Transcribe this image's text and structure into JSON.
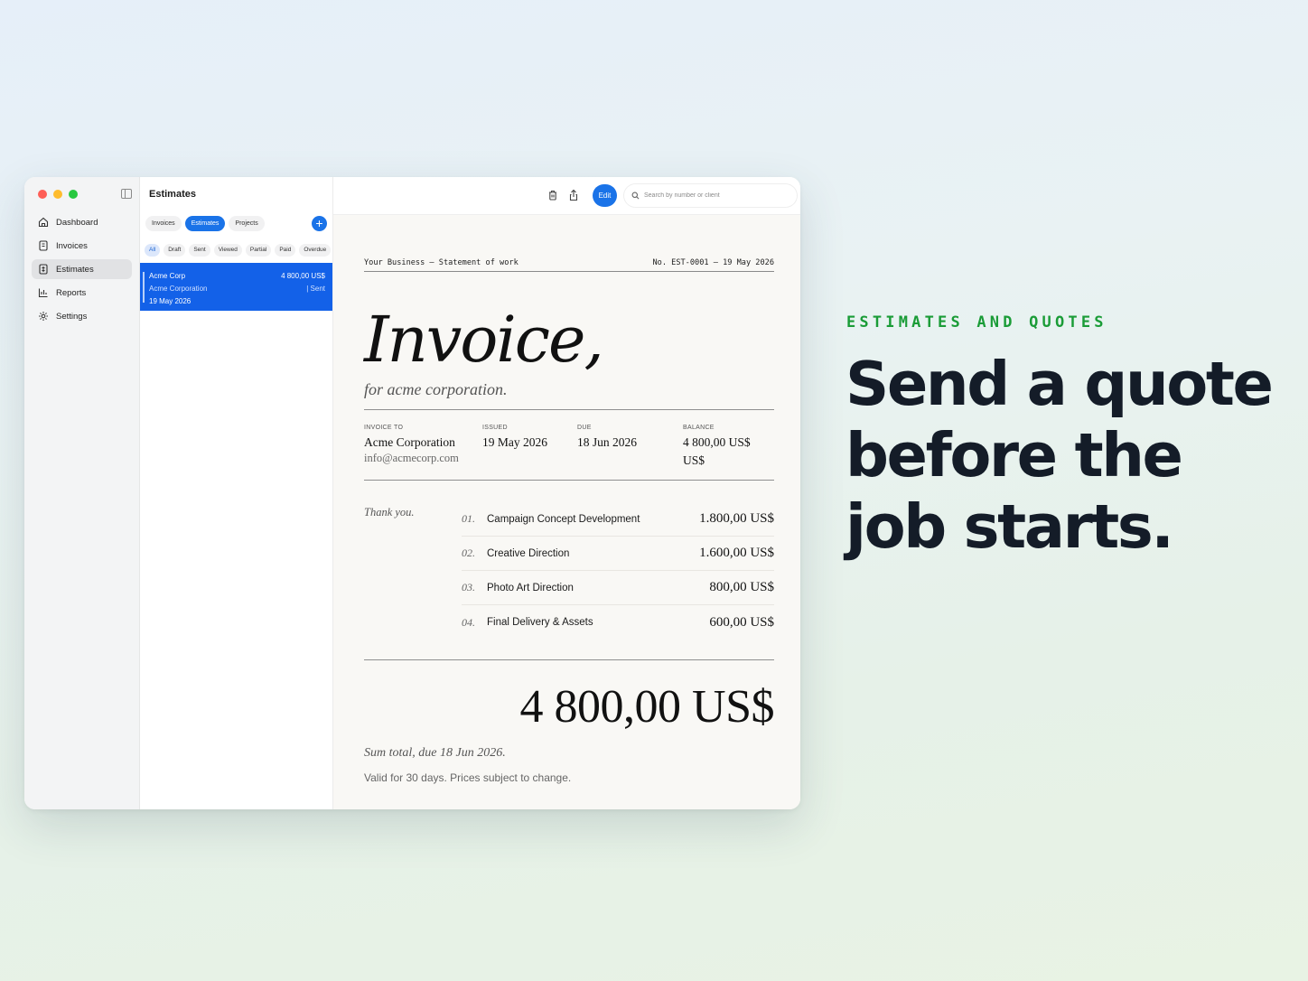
{
  "colors": {
    "accent": "#1a73e8",
    "selected_row": "#1361e8",
    "eyebrow_green": "#1a9c37",
    "headline": "#141c28",
    "traffic_red": "#fe5f57",
    "traffic_yellow": "#febc2e",
    "traffic_green": "#28c840"
  },
  "sidebar": {
    "items": [
      {
        "label": "Dashboard",
        "icon": "dashboard-icon"
      },
      {
        "label": "Invoices",
        "icon": "invoice-doc-icon"
      },
      {
        "label": "Estimates",
        "icon": "estimate-doc-icon",
        "active": true
      },
      {
        "label": "Reports",
        "icon": "bar-chart-icon"
      },
      {
        "label": "Settings",
        "icon": "gear-icon"
      }
    ]
  },
  "list": {
    "title": "Estimates",
    "segments": [
      "Invoices",
      "Estimates",
      "Projects"
    ],
    "active_segment": "Estimates",
    "filters": [
      "All",
      "Draft",
      "Sent",
      "Viewed",
      "Partial",
      "Paid",
      "Overdue"
    ],
    "active_filter": "All",
    "rows": [
      {
        "client": "Acme Corp",
        "amount": "4 800,00 US$",
        "company": "Acme Corporation",
        "status": "| Sent",
        "date": "19 May 2026"
      }
    ]
  },
  "toolbar": {
    "edit_label": "Edit",
    "search_placeholder": "Search by number or client"
  },
  "document": {
    "header_left": "Your Business — Statement of work",
    "header_right": "No. EST-0001 — 19 May 2026",
    "title": "Invoice,",
    "subtitle": "for acme corporation.",
    "meta": {
      "to_label": "INVOICE TO",
      "to_name": "Acme Corporation",
      "to_email": "info@acmecorp.com",
      "issued_label": "ISSUED",
      "issued": "19 May 2026",
      "due_label": "DUE",
      "due": "18 Jun 2026",
      "balance_label": "BALANCE",
      "balance": "4 800,00 US$",
      "balance_extra": "US$"
    },
    "thanks": "Thank you.",
    "items": [
      {
        "num": "01.",
        "desc": "Campaign Concept Development",
        "amount": "1.800,00 US$"
      },
      {
        "num": "02.",
        "desc": "Creative Direction",
        "amount": "1.600,00 US$"
      },
      {
        "num": "03.",
        "desc": "Photo Art Direction",
        "amount": "800,00 US$"
      },
      {
        "num": "04.",
        "desc": "Final Delivery & Assets",
        "amount": "600,00 US$"
      }
    ],
    "total": "4 800,00 US$",
    "sum_note": "Sum total, due 18 Jun 2026.",
    "valid_note": "Valid for 30 days. Prices subject to change."
  },
  "marketing": {
    "eyebrow": "ESTIMATES AND QUOTES",
    "headline": "Send a quote before the job starts."
  }
}
